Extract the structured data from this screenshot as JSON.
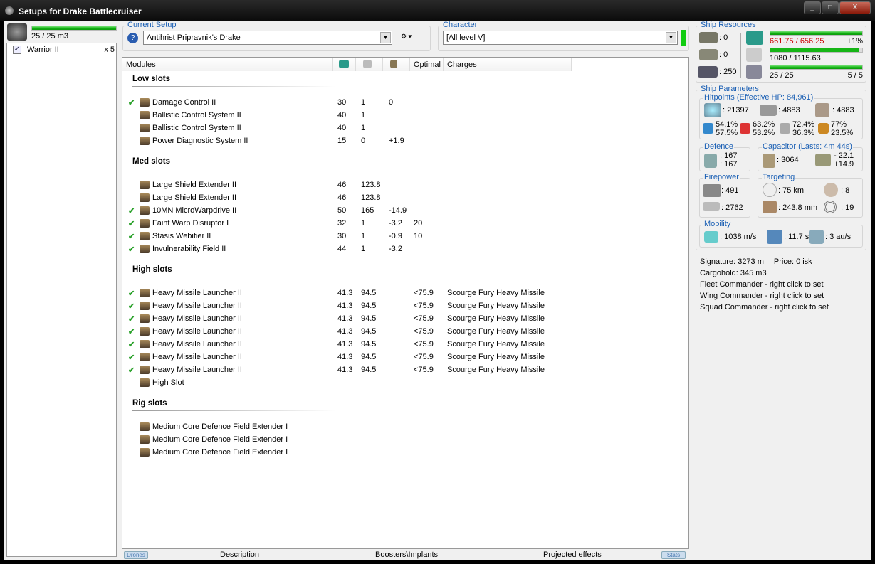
{
  "window": {
    "title": "Setups for Drake Battlecruiser",
    "buttons": [
      "_",
      "□",
      "X"
    ]
  },
  "drones": {
    "bay": "25 / 25 m3",
    "items": [
      {
        "name": "Warrior II",
        "count": "x 5",
        "checked": true
      }
    ]
  },
  "current_setup": {
    "label": "Current Setup",
    "value": "Antihrist Pripravnik's Drake"
  },
  "character": {
    "label": "Character",
    "value": "[All level V]"
  },
  "modules_table": {
    "headers": [
      "Modules",
      "",
      "",
      "",
      "Optimal",
      "Charges"
    ],
    "sections": [
      {
        "title": "Low slots",
        "rows": [
          {
            "name": "Damage Control II",
            "c1": "30",
            "c2": "1",
            "c3": "0",
            "opt": "",
            "charge": "",
            "active": true
          },
          {
            "name": "Ballistic Control System II",
            "c1": "40",
            "c2": "1",
            "c3": "",
            "opt": "",
            "charge": "",
            "active": false
          },
          {
            "name": "Ballistic Control System II",
            "c1": "40",
            "c2": "1",
            "c3": "",
            "opt": "",
            "charge": "",
            "active": false
          },
          {
            "name": "Power Diagnostic System II",
            "c1": "15",
            "c2": "0",
            "c3": "+1.9",
            "opt": "",
            "charge": "",
            "active": false
          }
        ]
      },
      {
        "title": "Med slots",
        "rows": [
          {
            "name": "Large Shield Extender II",
            "c1": "46",
            "c2": "123.8",
            "c3": "",
            "opt": "",
            "charge": "",
            "active": false
          },
          {
            "name": "Large Shield Extender II",
            "c1": "46",
            "c2": "123.8",
            "c3": "",
            "opt": "",
            "charge": "",
            "active": false
          },
          {
            "name": "10MN MicroWarpdrive II",
            "c1": "50",
            "c2": "165",
            "c3": "-14.9",
            "opt": "",
            "charge": "",
            "active": true
          },
          {
            "name": "Faint Warp Disruptor I",
            "c1": "32",
            "c2": "1",
            "c3": "-3.2",
            "opt": "20",
            "charge": "",
            "active": true
          },
          {
            "name": "Stasis Webifier II",
            "c1": "30",
            "c2": "1",
            "c3": "-0.9",
            "opt": "10",
            "charge": "",
            "active": true
          },
          {
            "name": "Invulnerability Field II",
            "c1": "44",
            "c2": "1",
            "c3": "-3.2",
            "opt": "",
            "charge": "",
            "active": true
          }
        ]
      },
      {
        "title": "High slots",
        "rows": [
          {
            "name": "Heavy Missile Launcher II",
            "c1": "41.3",
            "c2": "94.5",
            "c3": "",
            "opt": "<75.9",
            "charge": "Scourge Fury Heavy Missile",
            "active": true
          },
          {
            "name": "Heavy Missile Launcher II",
            "c1": "41.3",
            "c2": "94.5",
            "c3": "",
            "opt": "<75.9",
            "charge": "Scourge Fury Heavy Missile",
            "active": true
          },
          {
            "name": "Heavy Missile Launcher II",
            "c1": "41.3",
            "c2": "94.5",
            "c3": "",
            "opt": "<75.9",
            "charge": "Scourge Fury Heavy Missile",
            "active": true
          },
          {
            "name": "Heavy Missile Launcher II",
            "c1": "41.3",
            "c2": "94.5",
            "c3": "",
            "opt": "<75.9",
            "charge": "Scourge Fury Heavy Missile",
            "active": true
          },
          {
            "name": "Heavy Missile Launcher II",
            "c1": "41.3",
            "c2": "94.5",
            "c3": "",
            "opt": "<75.9",
            "charge": "Scourge Fury Heavy Missile",
            "active": true
          },
          {
            "name": "Heavy Missile Launcher II",
            "c1": "41.3",
            "c2": "94.5",
            "c3": "",
            "opt": "<75.9",
            "charge": "Scourge Fury Heavy Missile",
            "active": true
          },
          {
            "name": "Heavy Missile Launcher II",
            "c1": "41.3",
            "c2": "94.5",
            "c3": "",
            "opt": "<75.9",
            "charge": "Scourge Fury Heavy Missile",
            "active": true
          },
          {
            "name": "High Slot",
            "c1": "",
            "c2": "",
            "c3": "",
            "opt": "",
            "charge": "",
            "active": false
          }
        ]
      },
      {
        "title": "Rig slots",
        "rows": [
          {
            "name": "Medium Core Defence Field Extender I",
            "c1": "",
            "c2": "",
            "c3": "",
            "opt": "",
            "charge": "",
            "active": false
          },
          {
            "name": "Medium Core Defence Field Extender I",
            "c1": "",
            "c2": "",
            "c3": "",
            "opt": "",
            "charge": "",
            "active": false
          },
          {
            "name": "Medium Core Defence Field Extender I",
            "c1": "",
            "c2": "",
            "c3": "",
            "opt": "",
            "charge": "",
            "active": false
          }
        ]
      }
    ]
  },
  "bottom_tabs": {
    "left": "Drones",
    "description": "Description",
    "boosters": "Boosters\\Implants",
    "projected": "Projected effects",
    "right": "Stats"
  },
  "resources": {
    "label": "Ship Resources",
    "turrets": ": 0",
    "launchers_free": ": 0",
    "calibration": ": 250",
    "cpu": "661.75 / 656.25",
    "cpu_pct": "+1%",
    "powergrid": "1080 / 1115.63",
    "drone_bw": "25 / 25",
    "drones_active": "5 / 5",
    "cpu_fill": 1.0,
    "pg_fill": 0.97,
    "bw_fill": 1.0
  },
  "params": {
    "label": "Ship Parameters",
    "hitpoints": {
      "label": "Hitpoints (Effective HP: 84,961)",
      "shield": ": 21397",
      "armor": ": 4883",
      "structure": ": 4883",
      "resists": [
        [
          "54.1%",
          "57.5%"
        ],
        [
          "63.2%",
          "53.2%"
        ],
        [
          "72.4%",
          "36.3%"
        ],
        [
          "77%",
          "23.5%"
        ]
      ]
    },
    "defence": {
      "label": "Defence",
      "a": ": 167",
      "b": ": 167"
    },
    "capacitor": {
      "label": "Capacitor (Lasts: 4m 44s)",
      "amount": ": 3064",
      "use": "- 22.1",
      "recharge": "+14.9"
    },
    "firepower": {
      "label": "Firepower",
      "turret": ": 491",
      "missile": ": 2762"
    },
    "targeting": {
      "label": "Targeting",
      "range": ": 75 km",
      "targets": ": 8",
      "resolution": ": 243.8 mm",
      "sensor": ": 19"
    },
    "mobility": {
      "label": "Mobility",
      "speed": ": 1038 m/s",
      "align": ": 11.7 s",
      "warp": ": 3 au/s"
    }
  },
  "info": {
    "signature": "Signature: 3273 m",
    "price": "Price: 0 isk",
    "cargo": "Cargohold: 345 m3",
    "fleet": "Fleet Commander - right click to set",
    "wing": "Wing Commander - right click to set",
    "squad": "Squad Commander - right click to set"
  },
  "colors": {
    "accent": "#1a5fb4",
    "over": "#cc0000",
    "bar": "#16b516"
  }
}
